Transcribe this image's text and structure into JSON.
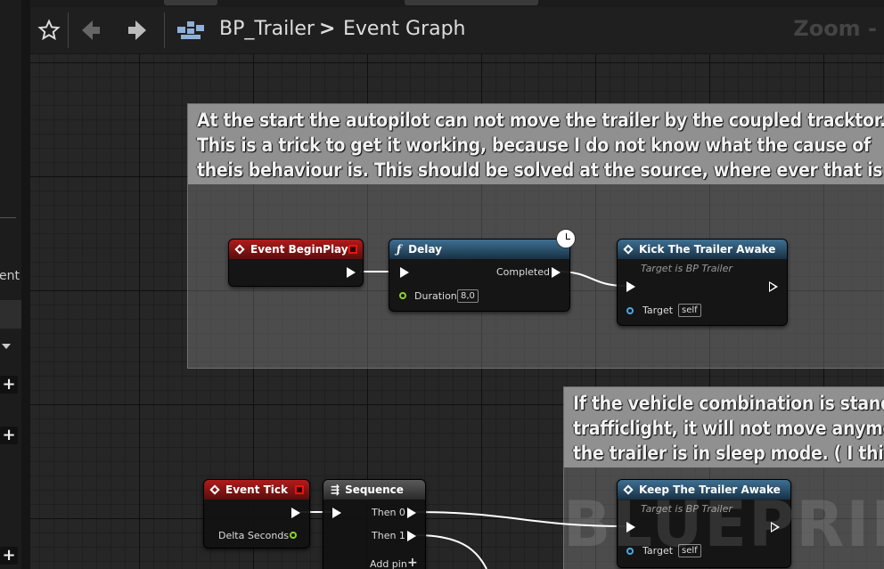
{
  "toolbar": {
    "breadcrumb_blueprint": "BP_Trailer",
    "breadcrumb_separator": ">",
    "breadcrumb_graph": "Event Graph",
    "zoom_label": "Zoom -"
  },
  "sidebar": {
    "clipped_text": "ent)",
    "add_buttons": [
      "+",
      "+",
      "+"
    ]
  },
  "comments": [
    {
      "text_lines": [
        "At the start the autopilot can not move the trailer by the coupled tracktor.",
        "This is a trick to get it working, because I do not know what the cause of",
        "theis behaviour is. This should be solved at the source, where ever that is"
      ]
    },
    {
      "text_lines": [
        "If the vehicle combination is stand",
        "trafficlight, it will not move anymo",
        "the trailer is in sleep mode. ( I thin"
      ]
    }
  ],
  "nodes": {
    "begin_play": {
      "title": "Event BeginPlay"
    },
    "delay": {
      "title": "Delay",
      "completed_label": "Completed",
      "duration_label": "Duration",
      "duration_value": "8,0"
    },
    "kick": {
      "title": "Kick The Trailer Awake",
      "subtitle": "Target is BP Trailer",
      "target_label": "Target",
      "target_value": "self"
    },
    "event_tick": {
      "title": "Event Tick",
      "delta_label": "Delta Seconds"
    },
    "sequence": {
      "title": "Sequence",
      "then0": "Then 0",
      "then1": "Then 1",
      "add_pin": "Add pin"
    },
    "keep": {
      "title": "Keep The Trailer Awake",
      "subtitle": "Target is BP Trailer",
      "target_label": "Target",
      "target_value": "self"
    }
  },
  "watermark": "BLUEPRINT",
  "icons": [
    "star-icon",
    "back-arrow-icon",
    "forward-arrow-icon",
    "blueprint-graph-icon",
    "function-icon",
    "clock-icon",
    "sequence-icon",
    "plus-icon"
  ],
  "colors": {
    "event_header": "#b11b1b",
    "function_header": "#3f6f91",
    "float_pin": "#8fd12e",
    "object_pin": "#4fa7e0"
  }
}
